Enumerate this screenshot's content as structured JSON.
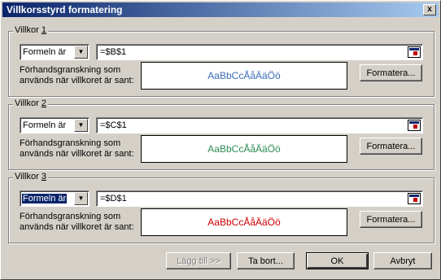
{
  "window": {
    "title": "Villkorsstyrd formatering",
    "close_label": "x"
  },
  "conditions": [
    {
      "legend": "Villkor",
      "number": "1",
      "operator": "Formeln är",
      "formula": "=$B$1",
      "preview_label": "Förhandsgranskning som används när villkoret är sant:",
      "preview_text": "AaBbCcÅåÄäÖö",
      "preview_color": "#3c6db4",
      "format_button": "Formatera..."
    },
    {
      "legend": "Villkor",
      "number": "2",
      "operator": "Formeln är",
      "formula": "=$C$1",
      "preview_label": "Förhandsgranskning som används när villkoret är sant:",
      "preview_text": "AaBbCcÅåÄäÖö",
      "preview_color": "#2e8b57",
      "format_button": "Formatera..."
    },
    {
      "legend": "Villkor",
      "number": "3",
      "operator": "Formeln är",
      "formula": "=$D$1",
      "preview_label": "Förhandsgranskning som används när villkoret är sant:",
      "preview_text": "AaBbCcÅåÄäÖö",
      "preview_color": "#cc0000",
      "format_button": "Formatera..."
    }
  ],
  "buttons": {
    "add": "Lägg till >>",
    "remove": "Ta bort...",
    "ok": "OK",
    "cancel": "Avbryt"
  }
}
